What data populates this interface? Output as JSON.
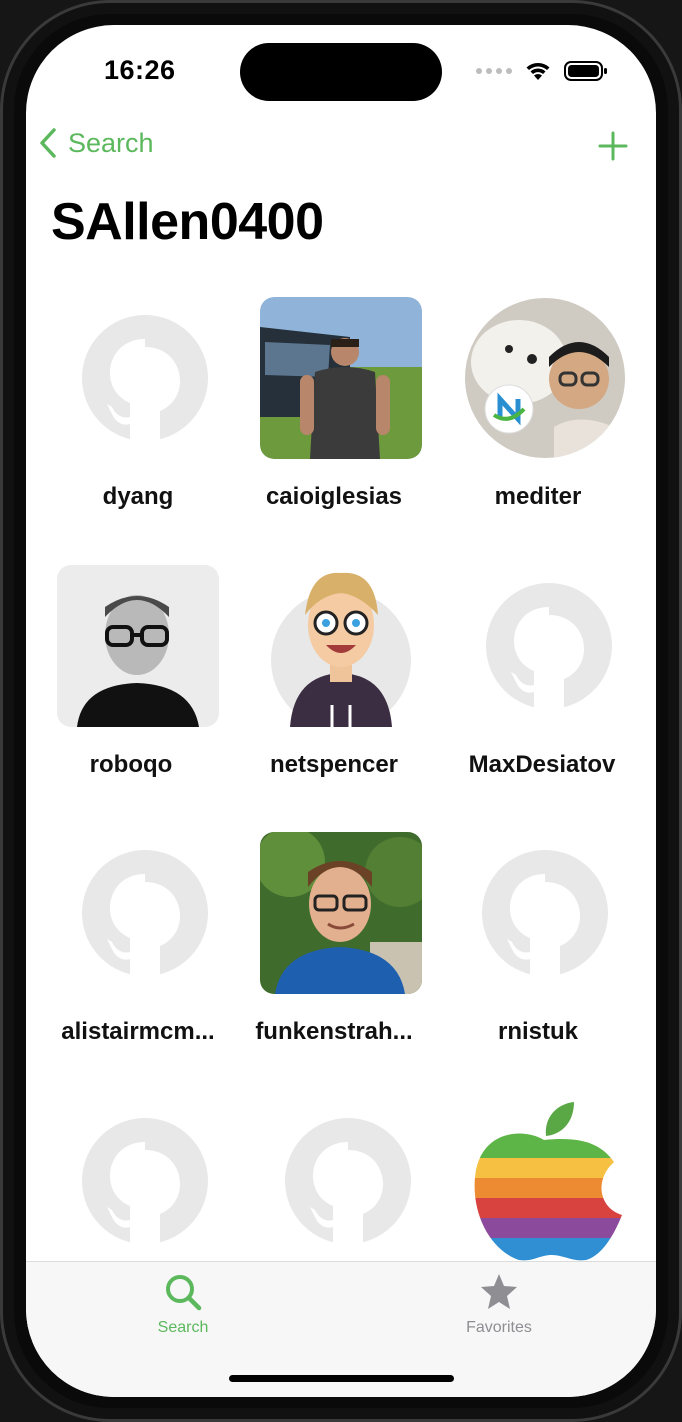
{
  "status": {
    "time": "16:26"
  },
  "nav": {
    "back_label": "Search"
  },
  "page_title": "SAllen0400",
  "users": [
    {
      "name": "dyang",
      "avatar": "github-octocat"
    },
    {
      "name": "caioiglesias",
      "avatar": "photo"
    },
    {
      "name": "mediter",
      "avatar": "photo"
    },
    {
      "name": "roboqo",
      "avatar": "photo"
    },
    {
      "name": "netspencer",
      "avatar": "cartoon"
    },
    {
      "name": "MaxDesiatov",
      "avatar": "github-octocat"
    },
    {
      "name": "alistairmcm...",
      "avatar": "github-octocat"
    },
    {
      "name": "funkenstrah...",
      "avatar": "photo"
    },
    {
      "name": "rnistuk",
      "avatar": "github-octocat"
    },
    {
      "name": "",
      "avatar": "github-octocat"
    },
    {
      "name": "",
      "avatar": "github-octocat"
    },
    {
      "name": "",
      "avatar": "rainbow-apple-logo"
    }
  ],
  "tabs": [
    {
      "label": "Search",
      "icon": "search-icon",
      "selected": true
    },
    {
      "label": "Favorites",
      "icon": "star-icon",
      "selected": false
    }
  ],
  "colors": {
    "accent": "#5cb85c",
    "inactive": "#8e8e93",
    "placeholder": "#e8e8e8"
  }
}
